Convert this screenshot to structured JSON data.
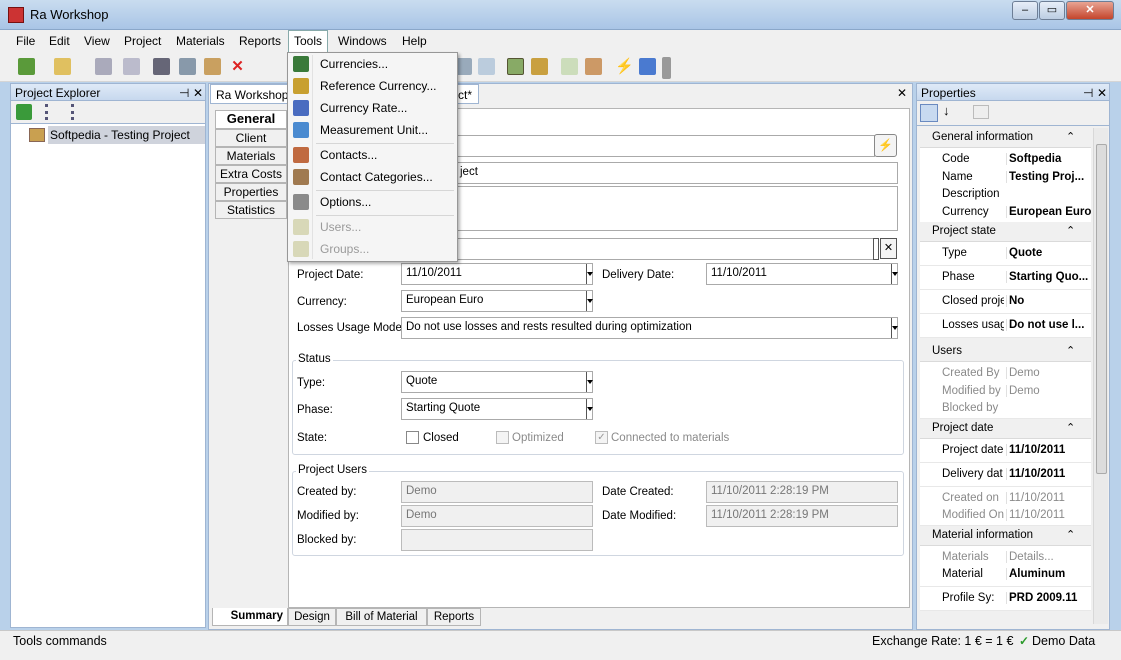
{
  "window": {
    "title": "Ra Workshop",
    "min": "–",
    "max": "▭",
    "close": "✕"
  },
  "menubar": [
    "File",
    "Edit",
    "View",
    "Project",
    "Materials",
    "Reports",
    "Tools",
    "Windows",
    "Help"
  ],
  "tools_menu": {
    "items": [
      {
        "label": "Currencies...",
        "enabled": true,
        "icon": "currencies-icon",
        "color": "#3a7a3a"
      },
      {
        "label": "Reference Currency...",
        "enabled": true,
        "icon": "reference-currency-icon",
        "color": "#c8a030"
      },
      {
        "label": "Currency Rate...",
        "enabled": true,
        "icon": "currency-rate-icon",
        "color": "#4a6cc0"
      },
      {
        "label": "Measurement Unit...",
        "enabled": true,
        "icon": "measurement-unit-icon",
        "color": "#4a8ad0"
      },
      {
        "label": "Contacts...",
        "enabled": true,
        "icon": "contacts-icon",
        "color": "#c06a40"
      },
      {
        "label": "Contact Categories...",
        "enabled": true,
        "icon": "contact-categories-icon",
        "color": "#a07a50"
      },
      {
        "label": "Options...",
        "enabled": true,
        "icon": "options-icon",
        "color": "#8a8a8a"
      },
      {
        "label": "Users...",
        "enabled": false,
        "icon": "users-icon",
        "color": "#c9c9a0"
      },
      {
        "label": "Groups...",
        "enabled": false,
        "icon": "groups-icon",
        "color": "#c9c9a0"
      }
    ]
  },
  "project_explorer": {
    "title": "Project Explorer",
    "pin": "⊣",
    "close": "✕",
    "tree_item": "Softpedia - Testing Project"
  },
  "document": {
    "tab_label": "Ra Workshop N",
    "tab_label_right": "ct*",
    "close": "✕"
  },
  "side_tabs": [
    "General",
    "Client",
    "Materials",
    "Extra Costs",
    "Properties",
    "Statistics"
  ],
  "form": {
    "code_partial": "",
    "name_partial": "ject",
    "project_date_label": "Project Date:",
    "project_date": "11/10/2011",
    "delivery_date_label": "Delivery Date:",
    "delivery_date": "11/10/2011",
    "currency_label": "Currency:",
    "currency": "European Euro",
    "losses_label": "Losses Usage Mode:",
    "losses": "Do not use losses and rests resulted during optimization",
    "status_title": "Status",
    "type_label": "Type:",
    "type": "Quote",
    "phase_label": "Phase:",
    "phase": "Starting Quote",
    "state_label": "State:",
    "closed_label": "Closed",
    "optimized_label": "Optimized",
    "connected_label": "Connected to materials",
    "users_title": "Project Users",
    "created_by_label": "Created by:",
    "created_by": "Demo",
    "modified_by_label": "Modified by:",
    "modified_by": "Demo",
    "blocked_by_label": "Blocked by:",
    "blocked_by": "",
    "date_created_label": "Date Created:",
    "date_created": "11/10/2011 2:28:19 PM",
    "date_modified_label": "Date Modified:",
    "date_modified": "11/10/2011 2:28:19 PM"
  },
  "bottom_tabs": [
    "Summary",
    "Design",
    "Bill of Material",
    "Reports"
  ],
  "properties": {
    "title": "Properties",
    "sections": [
      {
        "title": "General information",
        "rows": [
          [
            "Code",
            "Softpedia"
          ],
          [
            "Name",
            "Testing Proj..."
          ],
          [
            "Description",
            ""
          ],
          [
            "Currency",
            "European Euro"
          ]
        ]
      },
      {
        "title": "Project state",
        "rows": [
          [
            "Type",
            "Quote"
          ],
          [
            "Phase",
            "Starting Quo..."
          ],
          [
            "Closed proje",
            "No"
          ],
          [
            "Losses usag",
            "Do not use l..."
          ]
        ]
      },
      {
        "title": "Users",
        "rows": [
          [
            "Created By",
            "Demo"
          ],
          [
            "Modified by",
            "Demo"
          ],
          [
            "Blocked by",
            ""
          ]
        ]
      },
      {
        "title": "Project date",
        "rows": [
          [
            "Project date",
            "11/10/2011"
          ],
          [
            "Delivery dat",
            "11/10/2011"
          ],
          [
            "Created on",
            "11/10/2011"
          ],
          [
            "Modified On",
            "11/10/2011"
          ]
        ]
      },
      {
        "title": "Material information",
        "rows": [
          [
            "Materials",
            "Details..."
          ],
          [
            "Material",
            "Aluminum"
          ],
          [
            "Profile Sy:",
            "PRD 2009.11"
          ]
        ]
      }
    ]
  },
  "statusbar": {
    "left": "Tools commands",
    "exchange": "Exchange Rate: 1 € = 1 €",
    "demo": "Demo Data",
    "check": "✓"
  }
}
